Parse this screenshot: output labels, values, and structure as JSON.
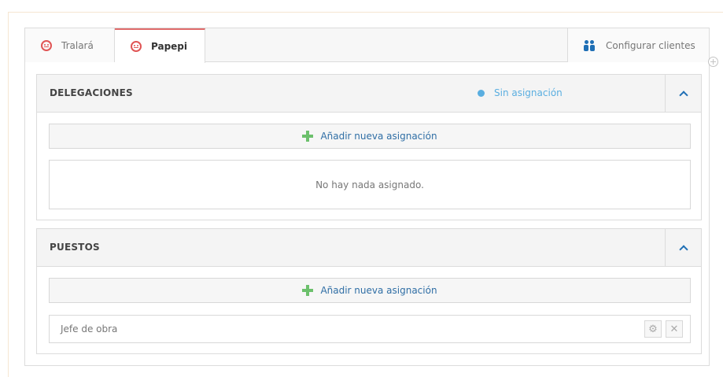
{
  "tabs": [
    {
      "label": "Tralará",
      "icon": "sad-face-icon"
    },
    {
      "label": "Papepi",
      "icon": "sad-face-icon"
    }
  ],
  "configure": {
    "label": "Configurar clientes",
    "icon": "people-icon"
  },
  "delegaciones": {
    "title": "DELEGACIONES",
    "status": "Sin asignación",
    "add_label": "Añadir nueva asignación",
    "empty_text": "No hay nada asignado."
  },
  "puestos": {
    "title": "PUESTOS",
    "add_label": "Añadir nueva asignación",
    "items": [
      {
        "label": "Jefe de obra"
      }
    ]
  },
  "colors": {
    "accent": "#1f6fb5",
    "tab_active_border": "#e06b6b",
    "status_dot": "#5aaee0",
    "add_icon": "#6cc06c",
    "face_icon": "#e05555"
  }
}
